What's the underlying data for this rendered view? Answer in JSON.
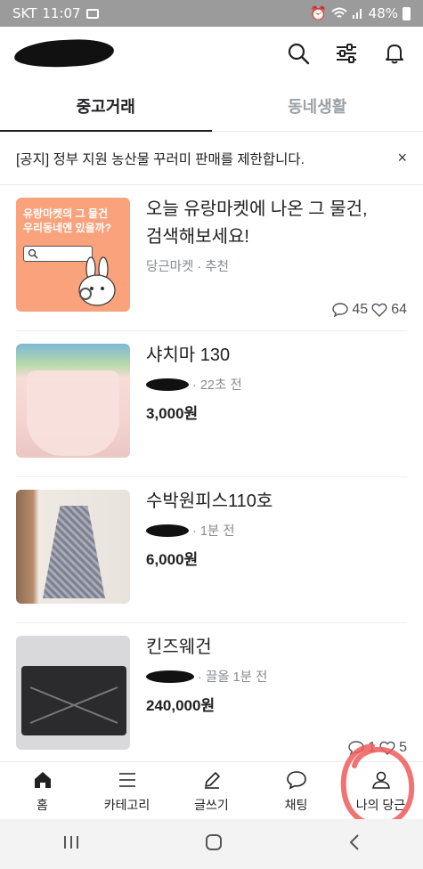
{
  "status_bar": {
    "carrier": "SKT",
    "time": "11:07",
    "battery": "48%"
  },
  "tabs": [
    {
      "label": "중고거래",
      "active": true
    },
    {
      "label": "동네생활",
      "active": false
    }
  ],
  "notice": {
    "text": "[공지] 정부 지원 농산물 꾸러미 판매를 제한합니다.",
    "close": "×"
  },
  "items": [
    {
      "title_line1": "오늘 유랑마켓에 나온 그 물건,",
      "title_line2": "검색해보세요!",
      "meta": "당근마켓 · 추천",
      "comments": "45",
      "likes": "64",
      "banner_line1": "유랑마켓의 그 물건",
      "banner_line2": "우리동네엔 있을까?"
    },
    {
      "title": "샤치마 130",
      "meta": "· 22초 전",
      "price": "3,000원"
    },
    {
      "title": "수박원피스110호",
      "meta": "· 1분 전",
      "price": "6,000원"
    },
    {
      "title": "킨즈웨건",
      "meta": "· 끌올 1분 전",
      "price": "240,000원",
      "comments": "1",
      "likes": "5"
    }
  ],
  "bottom_nav": [
    {
      "label": "홈",
      "icon": "home-icon"
    },
    {
      "label": "카테고리",
      "icon": "menu-icon"
    },
    {
      "label": "글쓰기",
      "icon": "pencil-icon"
    },
    {
      "label": "채팅",
      "icon": "chat-icon"
    },
    {
      "label": "나의 당근",
      "icon": "person-icon"
    }
  ],
  "colors": {
    "brand_peach": "#f9a27c",
    "highlight_circle": "#f05a5a",
    "status_bar": "#9b9b9b"
  }
}
